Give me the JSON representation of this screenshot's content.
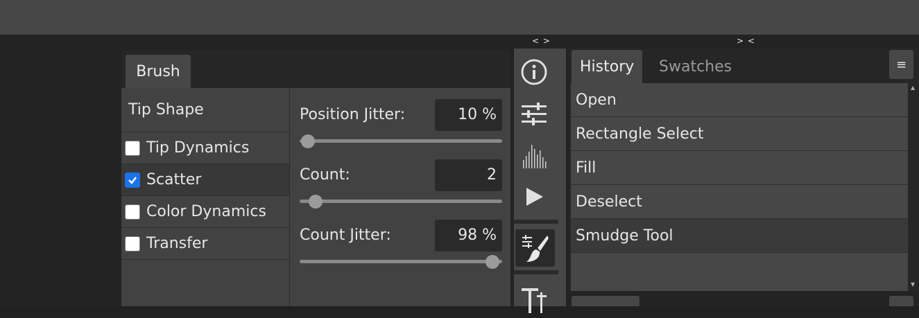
{
  "collapse": {
    "left": "< >",
    "right": "> <"
  },
  "brush": {
    "tab_label": "Brush",
    "sections": [
      {
        "label": "Tip Shape",
        "has_checkbox": false,
        "checked": false
      },
      {
        "label": "Tip Dynamics",
        "has_checkbox": true,
        "checked": false
      },
      {
        "label": "Scatter",
        "has_checkbox": true,
        "checked": true
      },
      {
        "label": "Color Dynamics",
        "has_checkbox": true,
        "checked": false
      },
      {
        "label": "Transfer",
        "has_checkbox": true,
        "checked": false
      }
    ],
    "fields": [
      {
        "label": "Position Jitter:",
        "value": "10 %",
        "slider_fraction": 0.04
      },
      {
        "label": "Count:",
        "value": "2",
        "slider_fraction": 0.08
      },
      {
        "label": "Count Jitter:",
        "value": "98 %",
        "slider_fraction": 0.953
      }
    ]
  },
  "toolbar": {
    "icons": [
      "info-icon",
      "adjustments-icon",
      "histogram-icon",
      "play-icon",
      "brush-settings-icon",
      "type-icon"
    ],
    "active": "brush-settings-icon"
  },
  "history": {
    "tabs": [
      "History",
      "Swatches"
    ],
    "active_tab": "History",
    "menu_glyph": "≡",
    "items": [
      "Open",
      "Rectangle Select",
      "Fill",
      "Deselect",
      "Smudge Tool"
    ],
    "selected_index": 4
  },
  "colors": {
    "accent": "#1a73e8",
    "panel": "#474747",
    "background": "#232323"
  }
}
